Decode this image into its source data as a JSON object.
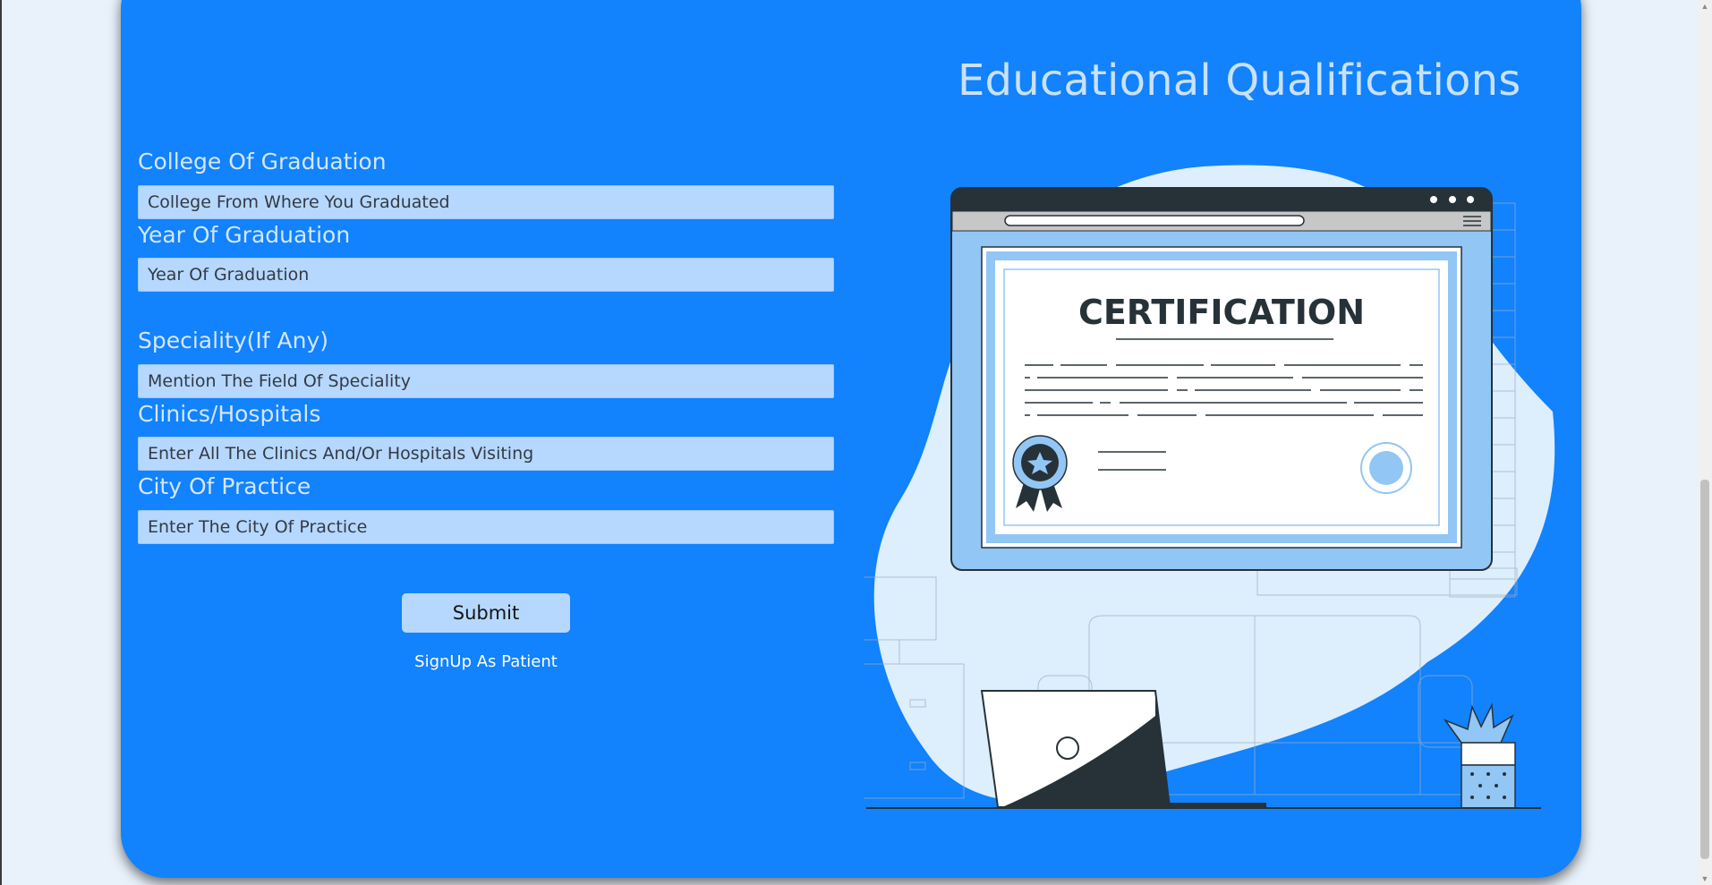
{
  "page": {
    "heading": "Educational Qualifications"
  },
  "form": {
    "fields": [
      {
        "label": "College Of Graduation",
        "placeholder": "College From Where You Graduated"
      },
      {
        "label": "Year Of Graduation",
        "placeholder": "Year Of Graduation"
      },
      {
        "label": "Speciality(If Any)",
        "placeholder": "Mention The Field Of Speciality"
      },
      {
        "label": "Clinics/Hospitals",
        "placeholder": "Enter All The Clinics And/Or Hospitals Visiting"
      },
      {
        "label": "City Of Practice",
        "placeholder": "Enter The City Of Practice"
      }
    ],
    "submit_label": "Submit",
    "signup_link": "SignUp As Patient"
  },
  "illustration": {
    "certificate_title": "CERTIFICATION",
    "icon": "certificate-illustration"
  },
  "colors": {
    "card": "#1282fd",
    "input": "#b6d8fe",
    "heading": "#c9e1fb"
  }
}
